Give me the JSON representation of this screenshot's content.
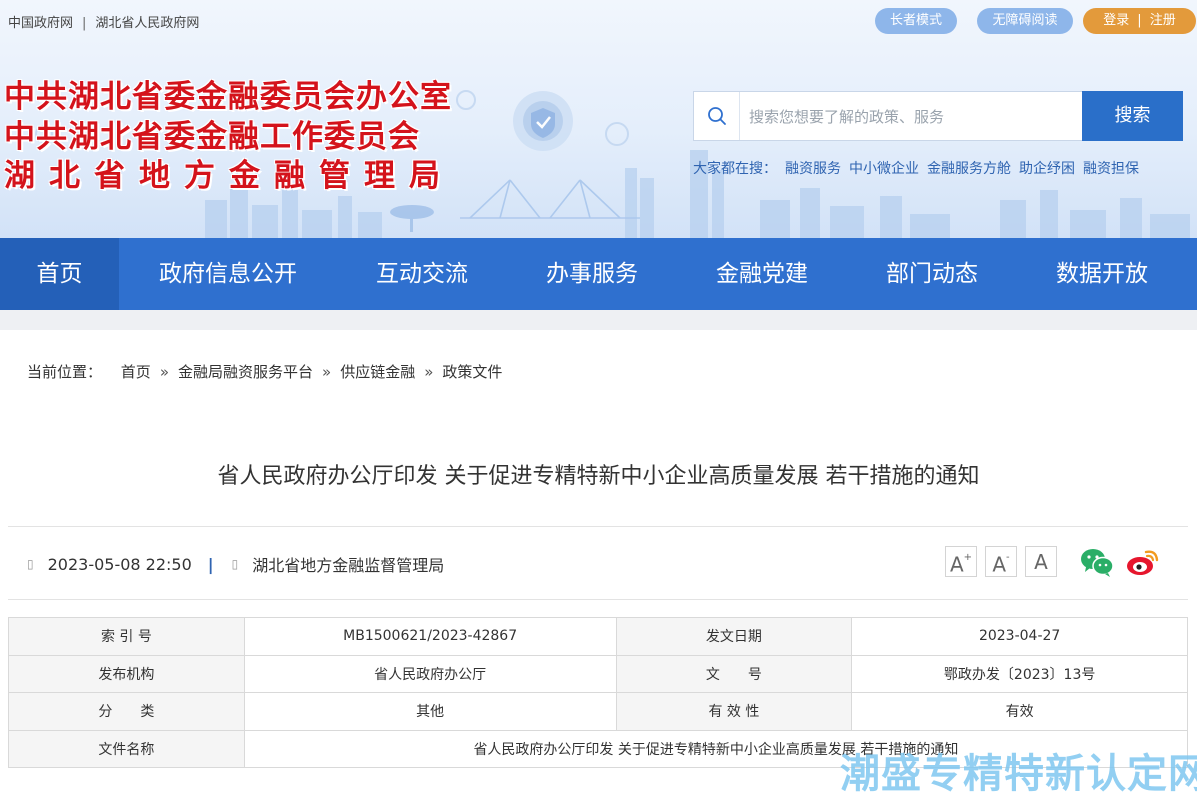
{
  "top_links": {
    "gov_cn": "中国政府网",
    "separator": "|",
    "hubei_gov": "湖北省人民政府网"
  },
  "top_buttons": {
    "elder_mode": "长者模式",
    "accessible_reading": "无障碍阅读",
    "login": "登录",
    "divider": "|",
    "register": "注册"
  },
  "site_title": {
    "line1": "中共湖北省委金融委员会办公室",
    "line2": "中共湖北省委金融工作委员会",
    "line3": "湖北省地方金融管理局"
  },
  "search": {
    "placeholder": "搜索您想要了解的政策、服务",
    "button": "搜索"
  },
  "hot_search": {
    "label": "大家都在搜：",
    "items": [
      "融资服务",
      "中小微企业",
      "金融服务方舱",
      "助企纾困",
      "融资担保"
    ]
  },
  "nav": {
    "items": [
      "首页",
      "政府信息公开",
      "互动交流",
      "办事服务",
      "金融党建",
      "部门动态",
      "数据开放"
    ],
    "active_index": 0
  },
  "breadcrumb": {
    "label": "当前位置：",
    "separator": "»",
    "items": [
      "首页",
      "金融局融资服务平台",
      "供应链金融",
      "政策文件"
    ]
  },
  "article": {
    "title": "省人民政府办公厅印发 关于促进专精特新中小企业高质量发展 若干措施的通知",
    "date": "2023-05-08 22:50",
    "meta_separator": "|",
    "source": "湖北省地方金融监督管理局",
    "glyph": "▯"
  },
  "font_size_buttons": {
    "increase": "A",
    "increase_mark": "+",
    "decrease": "A",
    "decrease_mark": "-",
    "reset": "A"
  },
  "share_icons": [
    "wechat-icon",
    "weibo-icon"
  ],
  "info_table": {
    "index_label": "索 引 号",
    "index_value": "MB1500621/2023-42867",
    "issue_date_label": "发文日期",
    "issue_date_value": "2023-04-27",
    "publisher_label": "发布机构",
    "publisher_value": "省人民政府办公厅",
    "doc_no_label": "文　　号",
    "doc_no_value": "鄂政办发〔2023〕13号",
    "category_label": "分　　类",
    "category_value": "其他",
    "validity_label": "有 效 性",
    "validity_value": "有效",
    "file_name_label": "文件名称",
    "file_name_value": "省人民政府办公厅印发 关于促进专精特新中小企业高质量发展 若干措施的通知"
  },
  "watermark": "潮盛专精特新认定网",
  "colors": {
    "nav_blue": "#2f70cf",
    "nav_active": "#2460b8",
    "title_red": "#d4131b",
    "login_orange": "#e39a3b",
    "pill_blue": "#8eb6ea",
    "link_blue": "#2f64b1"
  }
}
